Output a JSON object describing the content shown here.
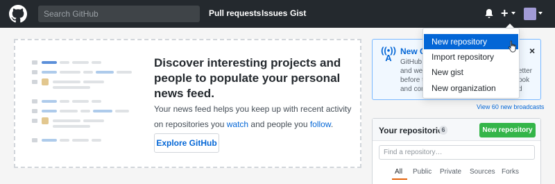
{
  "header": {
    "search_placeholder": "Search GitHub",
    "nav": [
      "Pull requests",
      "Issues",
      "Gist"
    ],
    "plus_symbol": "+"
  },
  "create_menu": {
    "items": [
      "New repository",
      "Import repository",
      "New gist",
      "New organization"
    ],
    "highlighted_index": 0
  },
  "feed": {
    "title": "Discover interesting projects and people to populate your personal news feed.",
    "body_before_watch": "Your news feed helps you keep up with recent activity on repositories you ",
    "watch_link": "watch",
    "body_middle": " and people you ",
    "follow_link": "follow",
    "body_end": ".",
    "explore_button": "Explore GitHub"
  },
  "broadcast": {
    "title_fragment": "New G",
    "line_fragments": [
      "GitHub i",
      "and we t",
      "before t",
      "and com"
    ],
    "right_fragments": [
      "etter",
      "ook",
      "d"
    ],
    "close_symbol": "×",
    "view_link": "View 60 new broadcasts"
  },
  "repositories": {
    "title": "Your repositories",
    "count": "6",
    "new_button": "New repository",
    "find_placeholder": "Find a repository…",
    "tabs": [
      "All",
      "Public",
      "Private",
      "Sources",
      "Forks"
    ],
    "active_tab": "All"
  },
  "colors": {
    "header_bg": "#24292e",
    "accent": "#0366d6",
    "new_repo_green": "#34b549",
    "active_tab_underline": "#e36209"
  }
}
